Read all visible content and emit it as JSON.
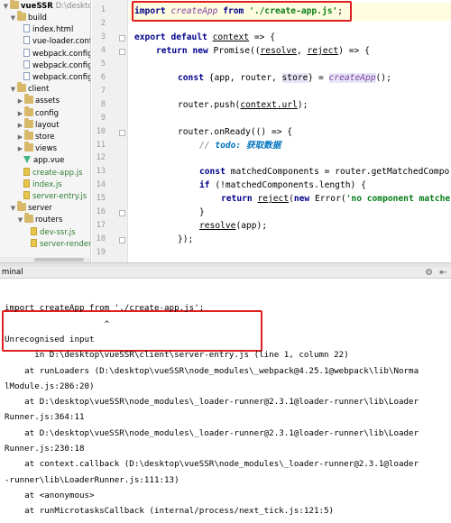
{
  "tree": {
    "project_name": "vueSSR",
    "project_path": "D:\\desktop\\vu",
    "items": [
      {
        "label": "build",
        "kind": "folder",
        "open": true
      },
      {
        "label": "index.html",
        "kind": "file"
      },
      {
        "label": "vue-loader.config",
        "kind": "file"
      },
      {
        "label": "webpack.config.b",
        "kind": "file"
      },
      {
        "label": "webpack.config.c",
        "kind": "file"
      },
      {
        "label": "webpack.config.s",
        "kind": "file"
      },
      {
        "label": "client",
        "kind": "folder",
        "open": true
      },
      {
        "label": "assets",
        "kind": "folder",
        "open": false
      },
      {
        "label": "config",
        "kind": "folder",
        "open": false
      },
      {
        "label": "layout",
        "kind": "folder",
        "open": false
      },
      {
        "label": "store",
        "kind": "folder",
        "open": false
      },
      {
        "label": "views",
        "kind": "folder",
        "open": false
      },
      {
        "label": "app.vue",
        "kind": "vue"
      },
      {
        "label": "create-app.js",
        "kind": "js"
      },
      {
        "label": "index.js",
        "kind": "js"
      },
      {
        "label": "server-entry.js",
        "kind": "js"
      },
      {
        "label": "server",
        "kind": "folder",
        "open": true
      },
      {
        "label": "routers",
        "kind": "folder",
        "open": true
      },
      {
        "label": "dev-ssr.js",
        "kind": "js"
      },
      {
        "label": "server-render",
        "kind": "js"
      }
    ]
  },
  "editor": {
    "line_numbers": [
      "1",
      "2",
      "3",
      "4",
      "5",
      "6",
      "7",
      "8",
      "9",
      "10",
      "11",
      "12",
      "13",
      "14",
      "15",
      "16",
      "17",
      "18",
      "19"
    ],
    "code": {
      "l1": {
        "kw": "import",
        "fn": "createApp",
        "from": "from",
        "str": "'./create-app.js'",
        "end": ";"
      },
      "l3": {
        "kw1": "export",
        "kw2": "default",
        "ctx": "context",
        "rest": " => {"
      },
      "l4": {
        "kw1": "return",
        "kw2": "new",
        "a": " Promise((",
        "resolve": "resolve",
        "comma": ", ",
        "reject": "reject",
        "b": ") => {"
      },
      "l6": {
        "kw": "const",
        "a": " {app, router, ",
        "store": "store",
        "b": "} = ",
        "fn": "createApp",
        "c": "();"
      },
      "l8": {
        "a": "router.push(",
        "ctx": "context.url",
        "b": ");"
      },
      "l10": {
        "a": "router.onReady(() => {"
      },
      "l11": {
        "a": "// ",
        "todo": "todo: 获取数据"
      },
      "l13": {
        "kw": "const",
        "a": " matchedComponents = router.getMatchedCompo"
      },
      "l14": {
        "kw": "if",
        "a": " (!matchedComponents.length) {"
      },
      "l15": {
        "kw1": "return",
        "reject": "reject",
        "a": "(",
        "kw2": "new",
        "b": " Error(",
        "str": "'no component matche"
      },
      "l16": {
        "a": "}"
      },
      "l17": {
        "resolve": "resolve",
        "a": "(app);"
      },
      "l18": {
        "a": "});"
      }
    }
  },
  "terminal": {
    "title": "minal",
    "lines": [
      "",
      "import createApp from './create-app.js';",
      "                    ^",
      "Unrecognised input",
      "      in D:\\desktop\\vueSSR\\client\\server-entry.js (line 1, column 22)",
      "    at runLoaders (D:\\desktop\\vueSSR\\node_modules\\_webpack@4.25.1@webpack\\lib\\Norma",
      "lModule.js:286:20)",
      "    at D:\\desktop\\vueSSR\\node_modules\\_loader-runner@2.3.1@loader-runner\\lib\\Loader",
      "Runner.js:364:11",
      "    at D:\\desktop\\vueSSR\\node_modules\\_loader-runner@2.3.1@loader-runner\\lib\\Loader",
      "Runner.js:230:18",
      "    at context.callback (D:\\desktop\\vueSSR\\node_modules\\_loader-runner@2.3.1@loader",
      "-runner\\lib\\LoaderRunner.js:111:13)",
      "    at <anonymous>",
      "    at runMicrotasksCallback (internal/process/next_tick.js:121:5)"
    ]
  },
  "colors": {
    "highlight_box": "#e02020",
    "keyword": "#00008b",
    "string": "#067d17"
  }
}
